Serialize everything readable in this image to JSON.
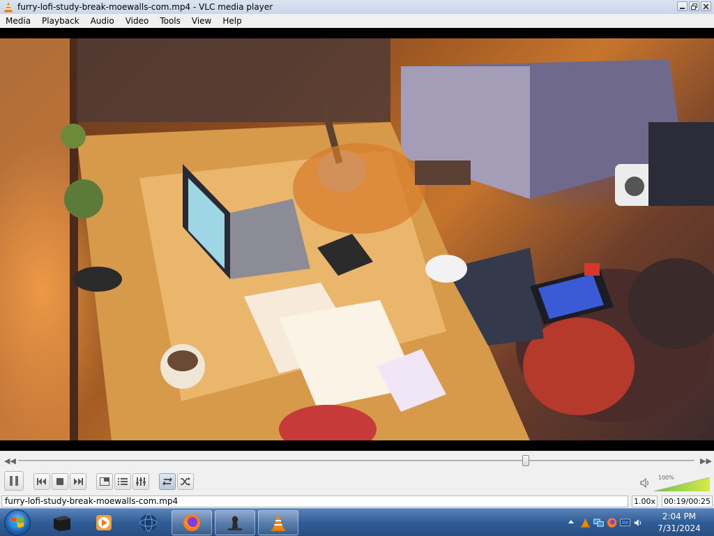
{
  "window": {
    "title": "furry-lofi-study-break-moewalls-com.mp4 - VLC media player"
  },
  "menu": {
    "items": [
      "Media",
      "Playback",
      "Audio",
      "Video",
      "Tools",
      "View",
      "Help"
    ]
  },
  "playback": {
    "progress": 0.75,
    "volume_label": "100%",
    "volume_level": 1.0
  },
  "status": {
    "filename": "furry-lofi-study-break-moewalls-com.mp4",
    "speed": "1.00x",
    "time": "00:19/00:25"
  },
  "taskbar": {
    "time": "2:04 PM",
    "date": "7/31/2024"
  },
  "icons": {
    "app": "vlc-cone-icon",
    "controls": [
      "pause-icon",
      "previous-icon",
      "stop-icon",
      "next-icon",
      "fullscreen-icon",
      "extended-settings-icon",
      "playlist-icon",
      "loop-icon",
      "shuffle-icon"
    ]
  }
}
